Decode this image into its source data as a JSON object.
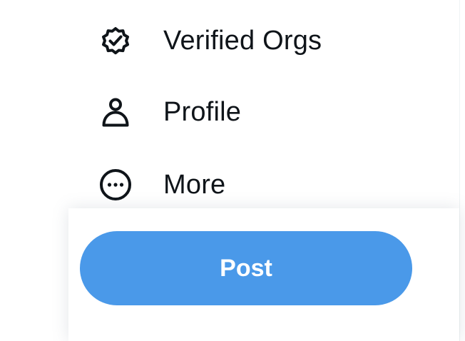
{
  "nav": {
    "items": [
      {
        "label": "Verified Orgs",
        "icon": "verified-badge-icon"
      },
      {
        "label": "Profile",
        "icon": "person-icon"
      },
      {
        "label": "More",
        "icon": "more-circle-icon"
      }
    ]
  },
  "post": {
    "label": "Post"
  },
  "colors": {
    "accent": "#4a99e9",
    "text": "#0f1419",
    "divider": "#eff3f4"
  }
}
